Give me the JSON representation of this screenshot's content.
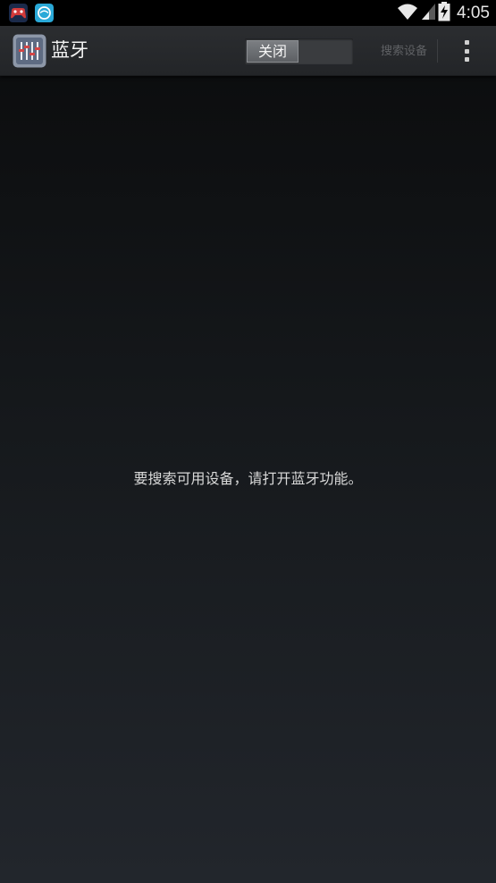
{
  "status_bar": {
    "time": "4:05",
    "icons": [
      "game-controller-icon",
      "app-notification-icon",
      "wifi-icon",
      "signal-icon",
      "battery-charging-icon"
    ]
  },
  "action_bar": {
    "title": "蓝牙",
    "app_icon": "equalizer-settings-icon",
    "toggle": {
      "state": "off",
      "label": "关闭"
    },
    "search_label": "搜索设备",
    "overflow_icon": "overflow-menu-icon"
  },
  "main": {
    "empty_message": "要搜索可用设备，请打开蓝牙功能。"
  },
  "colors": {
    "status_bar_bg": "#000000",
    "action_bar_bg": "#2b2d30",
    "background_top": "#0a0b0c",
    "background_bottom": "#22262c",
    "disabled_text": "#5f6164"
  }
}
